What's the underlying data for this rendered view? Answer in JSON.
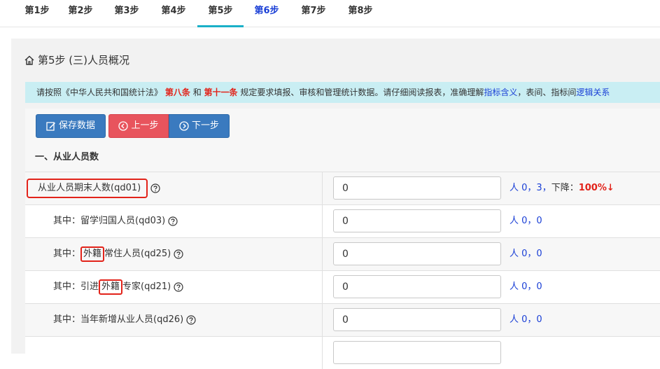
{
  "steps": [
    {
      "label": "第1步"
    },
    {
      "label": "第2步"
    },
    {
      "label": "第3步"
    },
    {
      "label": "第4步"
    },
    {
      "label": "第5步"
    },
    {
      "label": "第6步"
    },
    {
      "label": "第7步"
    },
    {
      "label": "第8步"
    }
  ],
  "page": {
    "title": "第5步 (三)人员概况",
    "notice": {
      "pre": "请按照《中华人民共和国统计法》",
      "art8": "第八条",
      "and": "和",
      "art11": "第十一条",
      "mid": "规定要求填报、审核和管理统计数据。请仔细阅读报表，准确理解",
      "link1": "指标含义",
      "mid2": "，表间、指标间",
      "link2": "逻辑关系"
    },
    "buttons": {
      "save": "保存数据",
      "prev": "上一步",
      "next": "下一步"
    },
    "section_title": "一、从业人员数"
  },
  "rows": [
    {
      "label": "从业人员期末人数(qd01)",
      "value": "0",
      "hint_unit": "人",
      "hint_vals": "0，3，",
      "hint_down": "下降：",
      "hint_pct": "100%↓"
    },
    {
      "prefix": "其中：",
      "label": "留学归国人员(qd03)",
      "value": "0",
      "hint_unit": "人",
      "hint_vals": "0，0"
    },
    {
      "prefix": "其中：",
      "hl": "外籍",
      "rest": "常住人员(qd25)",
      "value": "0",
      "hint_unit": "人",
      "hint_vals": "0，0"
    },
    {
      "prefix": "其中：",
      "pre_hl": "引进",
      "hl": "外籍",
      "rest": "专家(qd21)",
      "value": "0",
      "hint_unit": "人",
      "hint_vals": "0，0"
    },
    {
      "prefix": "其中：",
      "label": "当年新增从业人员(qd26)",
      "value": "0",
      "hint_unit": "人",
      "hint_vals": "0，0"
    }
  ]
}
